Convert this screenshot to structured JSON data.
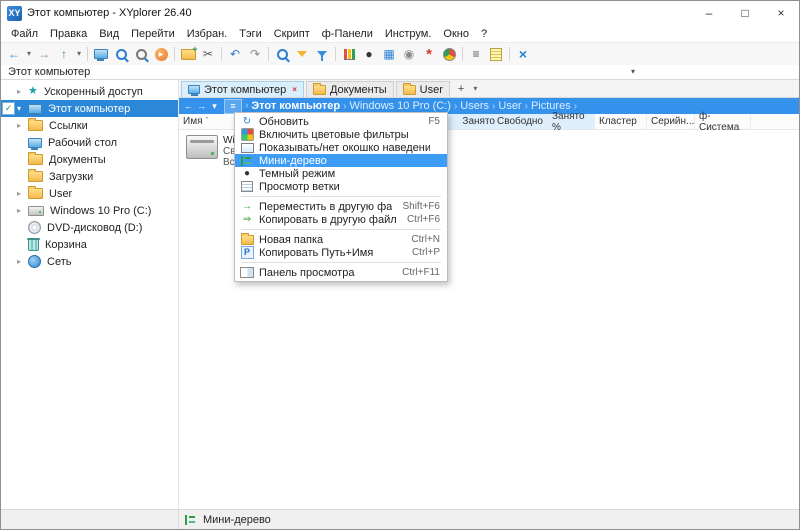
{
  "window": {
    "title": "Этот компьютер - XYplorer 26.40"
  },
  "menubar": {
    "items": [
      "Файл",
      "Правка",
      "Вид",
      "Перейти",
      "Избран.",
      "Тэги",
      "Скрипт",
      "ф-Панели",
      "Инструм.",
      "Окно",
      "?"
    ]
  },
  "toolbar": {
    "buttons": [
      "back",
      "back-history",
      "forward",
      "up",
      "up-history",
      "go-to-computer",
      "search",
      "hover-box",
      "run-script",
      "new-folder",
      "cut",
      "undo",
      "redo",
      "find-files",
      "filter",
      "visual-filter",
      "report",
      "dark-mode",
      "thumbnails",
      "settings",
      "favorites",
      "statistics",
      "list-view",
      "notes",
      "tools"
    ]
  },
  "addressbar": {
    "value": "Этот компьютер"
  },
  "tabs": {
    "items": [
      {
        "label": "Этот компьютер"
      },
      {
        "label": "Документы"
      },
      {
        "label": "User"
      }
    ]
  },
  "breadcrumb": {
    "separator": "›",
    "segments": [
      "Этот компьютер",
      "Windows 10 Pro (C:)",
      "Users",
      "User",
      "Pictures"
    ]
  },
  "columns": {
    "name": "Имя",
    "others": [
      "Занято",
      "Свободно",
      "Занято %",
      "Кластер",
      "Серийн...",
      "ф-Система"
    ]
  },
  "tree": {
    "items": [
      {
        "label": "Ускоренный доступ"
      },
      {
        "label": "Этот компьютер"
      },
      {
        "label": "Ссылки"
      },
      {
        "label": "Рабочий стол"
      },
      {
        "label": "Документы"
      },
      {
        "label": "Загрузки"
      },
      {
        "label": "User"
      },
      {
        "label": "Windows 10 Pro (C:)"
      },
      {
        "label": "DVD-дисковод (D:)"
      },
      {
        "label": "Корзина"
      },
      {
        "label": "Сеть"
      }
    ]
  },
  "files": {
    "item": {
      "name": "Windows...",
      "line1": "Свобо...",
      "line2": "Всего..."
    }
  },
  "menu": {
    "items": [
      {
        "label": "Обновить",
        "shortcut": "F5"
      },
      {
        "label": "Включить цветовые фильтры",
        "shortcut": ""
      },
      {
        "label": "Показывать/нет окошко наведения",
        "shortcut": ""
      },
      {
        "label": "Мини-дерево",
        "shortcut": ""
      },
      {
        "label": "Темный режим",
        "shortcut": ""
      },
      {
        "label": "Просмотр ветки",
        "shortcut": ""
      },
      {
        "label": "Переместить в другую файл-панель",
        "shortcut": "Shift+F6"
      },
      {
        "label": "Копировать в другую файл-панель",
        "shortcut": "Ctrl+F6"
      },
      {
        "label": "Новая папка",
        "shortcut": "Ctrl+N"
      },
      {
        "label": "Копировать Путь+Имя",
        "shortcut": "Ctrl+P"
      },
      {
        "label": "Панель просмотра",
        "shortcut": "Ctrl+F11"
      }
    ]
  },
  "statusbar": {
    "text": "Мини-дерево"
  },
  "colors": {
    "selection": "#2b88d8",
    "breadcrumb_bar": "#3492ec",
    "menu_highlight": "#3d9cf5",
    "tab_active": "#dbeefb"
  }
}
